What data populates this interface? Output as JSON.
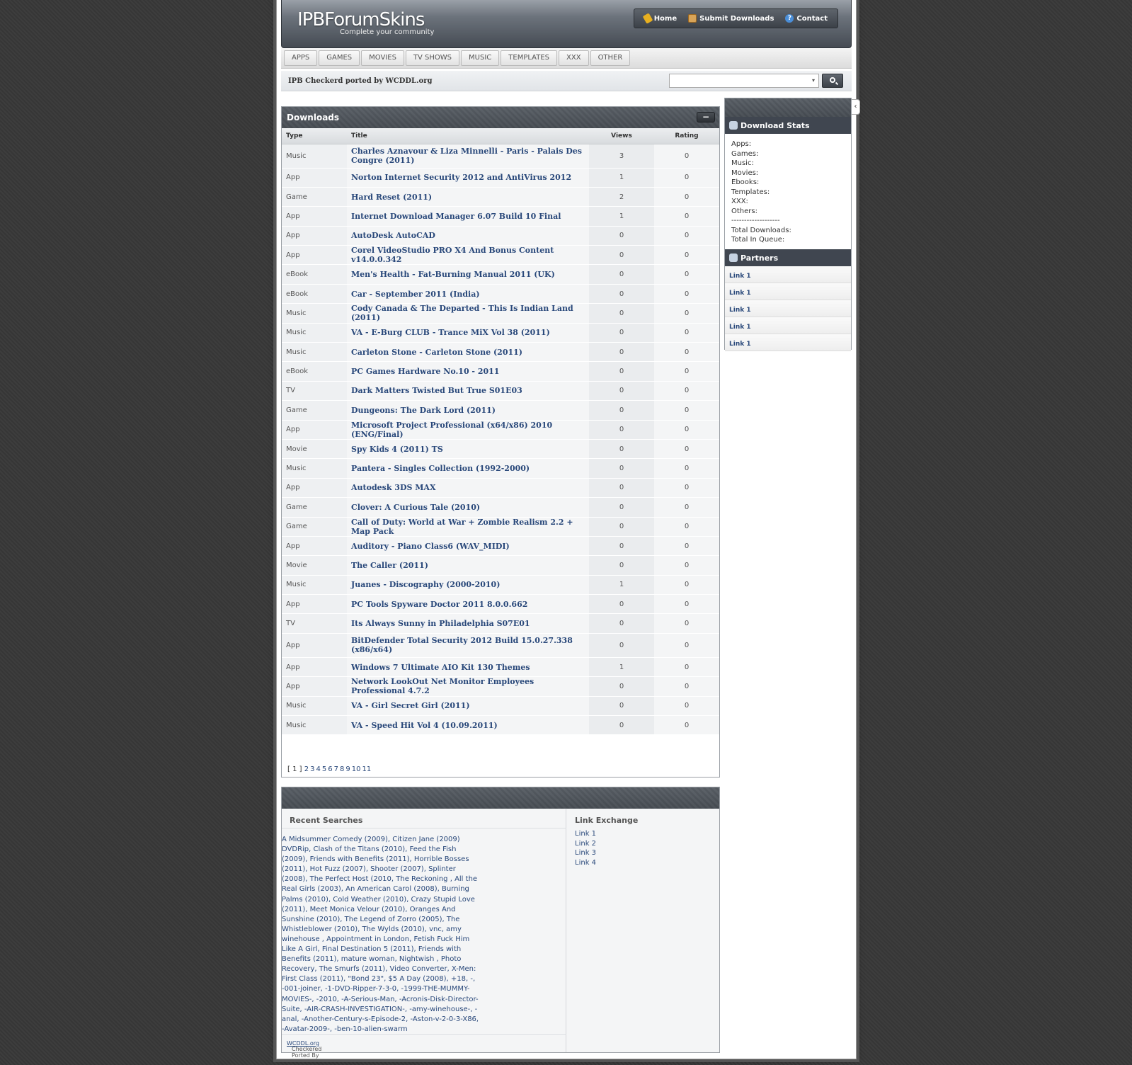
{
  "header": {
    "logo": "IPBForumSkins",
    "tagline": "Complete your community",
    "nav": [
      {
        "label": "Home",
        "icon": "key-icon"
      },
      {
        "label": "Submit Downloads",
        "icon": "box-icon"
      },
      {
        "label": "Contact",
        "icon": "help-icon"
      }
    ]
  },
  "categories": [
    "APPS",
    "GAMES",
    "MOVIES",
    "TV SHOWS",
    "MUSIC",
    "TEMPLATES",
    "XXX",
    "OTHER"
  ],
  "subbar": {
    "ported": "IPB Checkerd ported by WCDDL.org",
    "search_value": "",
    "search_caret": "▾"
  },
  "downloads": {
    "title": "Downloads",
    "collapse": "−",
    "columns": {
      "type": "Type",
      "title": "Title",
      "views": "Views",
      "rating": "Rating"
    },
    "rows": [
      {
        "type": "Music",
        "title": "Charles Aznavour & Liza Minnelli - Paris - Palais Des Congre (2011)",
        "views": "3",
        "rating": "0"
      },
      {
        "type": "App",
        "title": "Norton Internet Security 2012 and AntiVirus 2012",
        "views": "1",
        "rating": "0"
      },
      {
        "type": "Game",
        "title": "Hard Reset (2011)",
        "views": "2",
        "rating": "0"
      },
      {
        "type": "App",
        "title": "Internet Download Manager 6.07 Build 10 Final",
        "views": "1",
        "rating": "0"
      },
      {
        "type": "App",
        "title": "AutoDesk AutoCAD",
        "views": "0",
        "rating": "0"
      },
      {
        "type": "App",
        "title": "Corel VideoStudio PRO X4 And Bonus Content v14.0.0.342",
        "views": "0",
        "rating": "0"
      },
      {
        "type": "eBook",
        "title": "Men's Health - Fat-Burning Manual 2011 (UK)",
        "views": "0",
        "rating": "0"
      },
      {
        "type": "eBook",
        "title": "Car - September 2011 (India)",
        "views": "0",
        "rating": "0"
      },
      {
        "type": "Music",
        "title": "Cody Canada & The Departed - This Is Indian Land (2011)",
        "views": "0",
        "rating": "0"
      },
      {
        "type": "Music",
        "title": "VA - E-Burg CLUB - Trance MiX Vol 38 (2011)",
        "views": "0",
        "rating": "0"
      },
      {
        "type": "Music",
        "title": "Carleton Stone - Carleton Stone (2011)",
        "views": "0",
        "rating": "0"
      },
      {
        "type": "eBook",
        "title": "PC Games Hardware No.10 - 2011",
        "views": "0",
        "rating": "0"
      },
      {
        "type": "TV",
        "title": "Dark Matters Twisted But True S01E03",
        "views": "0",
        "rating": "0"
      },
      {
        "type": "Game",
        "title": "Dungeons: The Dark Lord (2011)",
        "views": "0",
        "rating": "0"
      },
      {
        "type": "App",
        "title": "Microsoft Project Professional (x64/x86) 2010 (ENG/Final)",
        "views": "0",
        "rating": "0"
      },
      {
        "type": "Movie",
        "title": "Spy Kids 4 (2011) TS",
        "views": "0",
        "rating": "0"
      },
      {
        "type": "Music",
        "title": "Pantera - Singles Collection (1992-2000)",
        "views": "0",
        "rating": "0"
      },
      {
        "type": "App",
        "title": "Autodesk 3DS MAX",
        "views": "0",
        "rating": "0"
      },
      {
        "type": "Game",
        "title": "Clover: A Curious Tale (2010)",
        "views": "0",
        "rating": "0"
      },
      {
        "type": "Game",
        "title": "Call of Duty: World at War + Zombie Realism 2.2 + Map Pack",
        "views": "0",
        "rating": "0"
      },
      {
        "type": "App",
        "title": "Auditory - Piano Class6 (WAV_MIDI)",
        "views": "0",
        "rating": "0"
      },
      {
        "type": "Movie",
        "title": "The Caller (2011)",
        "views": "0",
        "rating": "0"
      },
      {
        "type": "Music",
        "title": "Juanes - Discography (2000-2010)",
        "views": "1",
        "rating": "0"
      },
      {
        "type": "App",
        "title": "PC Tools Spyware Doctor 2011 8.0.0.662",
        "views": "0",
        "rating": "0"
      },
      {
        "type": "TV",
        "title": "Its Always Sunny in Philadelphia S07E01",
        "views": "0",
        "rating": "0"
      },
      {
        "type": "App",
        "title": "BitDefender Total Security 2012 Build 15.0.27.338 (x86/x64)",
        "views": "0",
        "rating": "0"
      },
      {
        "type": "App",
        "title": "Windows 7 Ultimate AIO Kit 130 Themes",
        "views": "1",
        "rating": "0"
      },
      {
        "type": "App",
        "title": "Network LookOut Net Monitor Employees Professional 4.7.2",
        "views": "0",
        "rating": "0"
      },
      {
        "type": "Music",
        "title": "VA - Girl Secret Girl (2011)",
        "views": "0",
        "rating": "0"
      },
      {
        "type": "Music",
        "title": "VA - Speed Hit Vol 4 (10.09.2011)",
        "views": "0",
        "rating": "0"
      }
    ],
    "pager": {
      "current": "[ 1 ]",
      "pages": [
        "2",
        "3",
        "4",
        "5",
        "6",
        "7",
        "8",
        "9",
        "10",
        "11"
      ]
    }
  },
  "sidebar": {
    "toggle": "‹",
    "stats_title": "Download Stats",
    "stats": [
      "Apps:",
      "Games:",
      "Music:",
      "Movies:",
      "Ebooks:",
      "Templates:",
      "XXX:",
      "Others:",
      "-------------------",
      "Total Downloads:",
      "Total In Queue:"
    ],
    "partners_title": "Partners",
    "partners": [
      "Link 1",
      "Link 1",
      "Link 1",
      "Link 1",
      "Link 1"
    ]
  },
  "bottom": {
    "recent_title": "Recent Searches",
    "recent_text": "A Midsummer Comedy (2009), Citizen Jane (2009) DVDRip, Clash of the Titans (2010), Feed the Fish (2009), Friends with Benefits (2011), Horrible Bosses (2011), Hot Fuzz (2007), Shooter (2007), Splinter (2008), The Perfect Host (2010, The Reckoning , All the Real Girls (2003), An American Carol (2008), Burning Palms (2010), Cold Weather (2010), Crazy Stupid Love (2011), Meet Monica Velour (2010), Oranges And Sunshine (2010), The Legend of Zorro (2005), The Whistleblower (2010), The Wylds (2010), vnc, amy winehouse , Appointment in London, Fetish Fuck Him Like A Girl, Final Destination 5 (2011), Friends with Benefits (2011), mature woman, Nightwish , Photo Recovery, The Smurfs (2011), Video Converter, X-Men: First Class (2011), \"Bond 23\", $5 A Day (2008), +18, -, -001-joiner, -1-DVD-Ripper-7-3-0, -1999-THE-MUMMY-MOVIES-, -2010, -A-Serious-Man, -Acronis-Disk-Director-Suite, -AIR-CRASH-INVESTIGATION-, -amy-winehouse-, -anal, -Another-Century-s-Episode-2, -Aston-v-2-0-3-X86, -Avatar-2009-, -ben-10-alien-swarm",
    "footer_prefix": "Checkered Ported By ",
    "footer_link": "WCDDL.org",
    "exchange_title": "Link Exchange",
    "exchange_links": [
      "Link 1",
      "Link 2",
      "Link 3",
      "Link 4"
    ]
  }
}
